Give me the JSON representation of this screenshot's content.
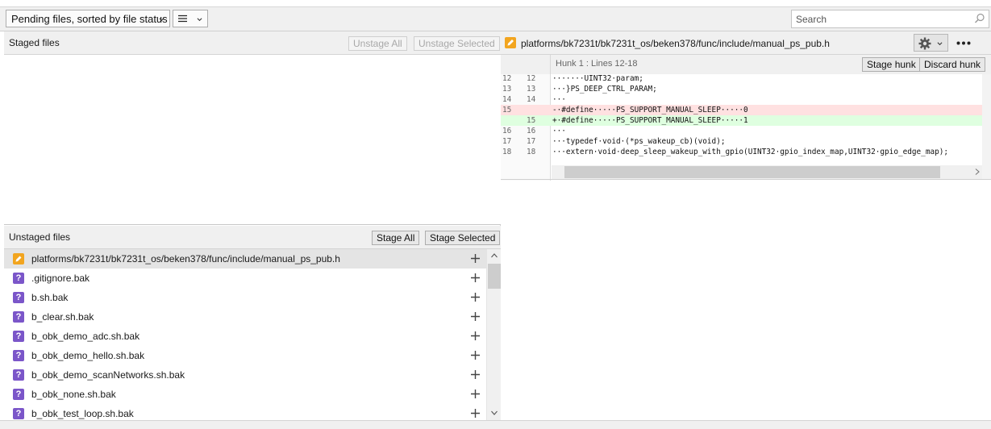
{
  "toolbar": {
    "sort_label": "Pending files, sorted by file status",
    "view_icon": "list-view-icon",
    "search_placeholder": "Search"
  },
  "staged": {
    "title": "Staged files",
    "unstage_all": "Unstage All",
    "unstage_selected": "Unstage Selected",
    "files": []
  },
  "unstaged": {
    "title": "Unstaged files",
    "stage_all": "Stage All",
    "stage_selected": "Stage Selected",
    "files": [
      {
        "name": "platforms/bk7231t/bk7231t_os/beken378/func/include/manual_ps_pub.h",
        "status": "modified",
        "icon": "pencil-icon"
      },
      {
        "name": ".gitignore.bak",
        "status": "untracked",
        "icon": "question-icon"
      },
      {
        "name": "b.sh.bak",
        "status": "untracked",
        "icon": "question-icon"
      },
      {
        "name": "b_clear.sh.bak",
        "status": "untracked",
        "icon": "question-icon"
      },
      {
        "name": "b_obk_demo_adc.sh.bak",
        "status": "untracked",
        "icon": "question-icon"
      },
      {
        "name": "b_obk_demo_hello.sh.bak",
        "status": "untracked",
        "icon": "question-icon"
      },
      {
        "name": "b_obk_demo_scanNetworks.sh.bak",
        "status": "untracked",
        "icon": "question-icon"
      },
      {
        "name": "b_obk_none.sh.bak",
        "status": "untracked",
        "icon": "question-icon"
      },
      {
        "name": "b_obk_test_loop.sh.bak",
        "status": "untracked",
        "icon": "question-icon"
      }
    ]
  },
  "diff": {
    "file_path": "platforms/bk7231t/bk7231t_os/beken378/func/include/manual_ps_pub.h",
    "hunk_title": "Hunk 1 : Lines 12-18",
    "stage_hunk": "Stage hunk",
    "discard_hunk": "Discard hunk",
    "lines": [
      {
        "old": "12",
        "new": "12",
        "type": "ctx",
        "text": "·······UINT32·param;"
      },
      {
        "old": "13",
        "new": "13",
        "type": "ctx",
        "text": "···}PS_DEEP_CTRL_PARAM;"
      },
      {
        "old": "14",
        "new": "14",
        "type": "ctx",
        "text": "···"
      },
      {
        "old": "15",
        "new": "",
        "type": "del",
        "text": "-·#define·····PS_SUPPORT_MANUAL_SLEEP·····0"
      },
      {
        "old": "",
        "new": "15",
        "type": "add",
        "text": "+·#define·····PS_SUPPORT_MANUAL_SLEEP·····1"
      },
      {
        "old": "16",
        "new": "16",
        "type": "ctx",
        "text": "···"
      },
      {
        "old": "17",
        "new": "17",
        "type": "ctx",
        "text": "···typedef·void·(*ps_wakeup_cb)(void);"
      },
      {
        "old": "18",
        "new": "18",
        "type": "ctx",
        "text": "···extern·void·deep_sleep_wakeup_with_gpio(UINT32·gpio_index_map,UINT32·gpio_edge_map);"
      }
    ]
  },
  "colors": {
    "modified": "#f2a51f",
    "untracked": "#7b56c9",
    "deleted_bg": "#ffe1e1",
    "added_bg": "#dfffe0"
  }
}
